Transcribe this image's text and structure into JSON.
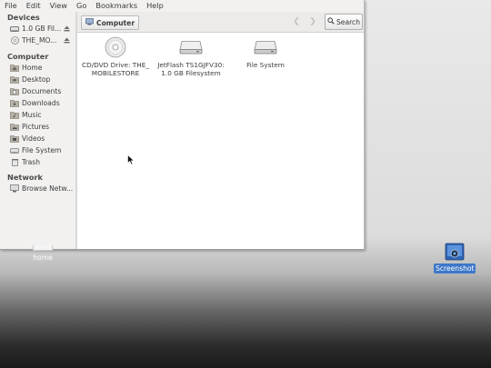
{
  "menubar": [
    "File",
    "Edit",
    "View",
    "Go",
    "Bookmarks",
    "Help"
  ],
  "sidebar": {
    "devices_title": "Devices",
    "devices": [
      {
        "label": "1.0 GB Fil...",
        "icon": "usb-drive-icon"
      },
      {
        "label": "THE_MO...",
        "icon": "optical-disc-icon"
      }
    ],
    "computer_title": "Computer",
    "computer": [
      {
        "label": "Home",
        "icon": "home-folder-icon"
      },
      {
        "label": "Desktop",
        "icon": "desktop-folder-icon"
      },
      {
        "label": "Documents",
        "icon": "documents-folder-icon"
      },
      {
        "label": "Downloads",
        "icon": "downloads-folder-icon"
      },
      {
        "label": "Music",
        "icon": "music-folder-icon"
      },
      {
        "label": "Pictures",
        "icon": "pictures-folder-icon"
      },
      {
        "label": "Videos",
        "icon": "videos-folder-icon"
      },
      {
        "label": "File System",
        "icon": "filesystem-icon"
      },
      {
        "label": "Trash",
        "icon": "trash-icon"
      }
    ],
    "network_title": "Network",
    "network": [
      {
        "label": "Browse Netw...",
        "icon": "network-icon"
      }
    ]
  },
  "toolbar": {
    "location": "Computer",
    "search_label": "Search"
  },
  "content": {
    "items": [
      {
        "name": "CD/DVD Drive: THE_ MOBILESTORE",
        "icon": "optical-disc-icon"
      },
      {
        "name": "JetFlash TS1GJFV30: 1.0 GB Filesystem",
        "icon": "usb-drive-icon"
      },
      {
        "name": "File System",
        "icon": "hard-drive-icon"
      }
    ]
  },
  "desktop": {
    "home_label": "home",
    "screenshot_label": "Screenshot"
  },
  "colors": {
    "accent": "#3d77c9",
    "window_bg": "#f2f1f0",
    "content_bg": "#ffffff"
  }
}
